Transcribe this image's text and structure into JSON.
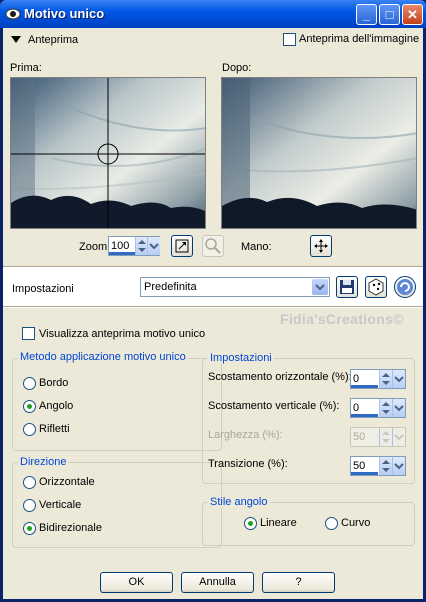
{
  "window": {
    "title": "Motivo unico",
    "minimize_glyph": "_",
    "maximize_glyph": "□",
    "close_glyph": "✕"
  },
  "preview_section": {
    "toggle_label": "Anteprima",
    "show_image_preview_label": "Anteprima dell'immagine",
    "before_label": "Prima:",
    "after_label": "Dopo:",
    "zoom_label": "Zoom:",
    "zoom_value": "100",
    "pan_label": "Mano:"
  },
  "settings": {
    "label": "Impostazioni",
    "preset_value": "Predefinita",
    "watermark": "Fidia'sCreations©"
  },
  "options": {
    "show_tile_preview_label": "Visualizza anteprima motivo unico",
    "method_group": {
      "title": "Metodo applicazione motivo unico",
      "items": [
        "Bordo",
        "Angolo",
        "Rifletti"
      ],
      "selected": "Angolo"
    },
    "direction_group": {
      "title": "Direzione",
      "items": [
        "Orizzontale",
        "Verticale",
        "Bidirezionale"
      ],
      "selected": "Bidirezionale"
    },
    "params_group": {
      "title": "Impostazioni",
      "h_offset_label": "Scostamento orizzontale (%):",
      "h_offset_value": "0",
      "v_offset_label": "Scostamento verticale (%):",
      "v_offset_value": "0",
      "width_label": "Larghezza (%):",
      "width_value": "50",
      "transition_label": "Transizione (%):",
      "transition_value": "50"
    },
    "corner_style_group": {
      "title": "Stile angolo",
      "items": [
        "Lineare",
        "Curvo"
      ],
      "selected": "Lineare"
    }
  },
  "footer": {
    "ok_label": "OK",
    "cancel_label": "Annulla",
    "help_label": "?"
  },
  "colors": {
    "title_bar": "#0058e6",
    "group_title": "#0046d5",
    "radio_dot": "#21a121"
  }
}
